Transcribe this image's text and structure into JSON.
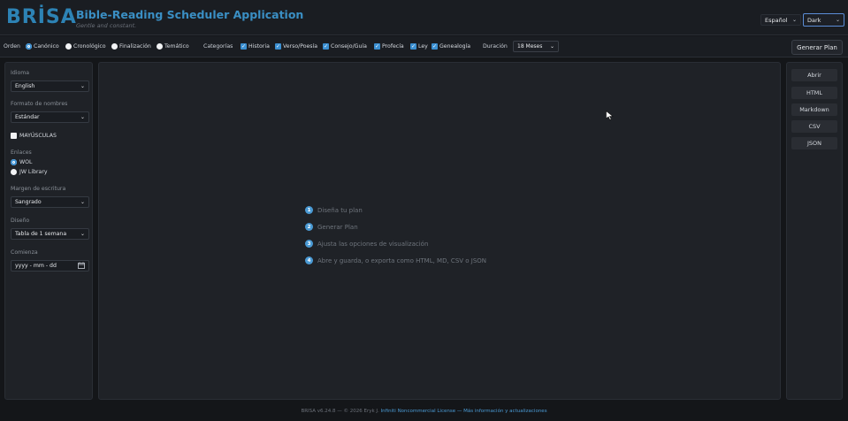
{
  "header": {
    "logo": "BRİSA",
    "title": "Bible-Reading Scheduler Application",
    "subtitle": "Gentle and constant.",
    "language": "Español",
    "theme": "Dark"
  },
  "toolbar": {
    "order_label": "Orden",
    "order_options": [
      {
        "label": "Canónico",
        "selected": true
      },
      {
        "label": "Cronológico",
        "selected": false
      },
      {
        "label": "Finalización",
        "selected": false
      },
      {
        "label": "Temático",
        "selected": false
      }
    ],
    "categories_label": "Categorías",
    "categories": [
      {
        "label": "Historia",
        "checked": true
      },
      {
        "label": "Verso/Poesía",
        "checked": true
      },
      {
        "label": "Consejo/Guía",
        "checked": true
      },
      {
        "label": "Profecía",
        "checked": true
      },
      {
        "label": "Ley",
        "checked": true
      },
      {
        "label": "Genealogía",
        "checked": true
      }
    ],
    "duration_label": "Duración",
    "duration_value": "18 Meses",
    "generate_label": "Generar Plan"
  },
  "sidebar": {
    "language_label": "Idioma",
    "language_value": "English",
    "name_format_label": "Formato de nombres",
    "name_format_value": "Estándar",
    "uppercase_label": "MAYÚSCULAS",
    "links_label": "Enlaces",
    "links_options": [
      {
        "label": "WOL",
        "selected": true
      },
      {
        "label": "JW Library",
        "selected": false
      }
    ],
    "margin_label": "Margen de escritura",
    "margin_value": "Sangrado",
    "design_label": "Diseño",
    "design_value": "Tabla de 1 semana",
    "start_label": "Comienza",
    "start_placeholder": "yyyy - mm - dd"
  },
  "main": {
    "steps": [
      {
        "num": "1",
        "text": "Diseña tu plan"
      },
      {
        "num": "2",
        "text": "Generar Plan"
      },
      {
        "num": "3",
        "text": "Ajusta las opciones de visualización"
      },
      {
        "num": "4",
        "text": "Abre y guarda, o exporta como HTML, MD, CSV o JSON"
      }
    ]
  },
  "actions": {
    "open": "Abrir",
    "html": "HTML",
    "markdown": "Markdown",
    "csv": "CSV",
    "json": "JSON"
  },
  "footer": {
    "text": "BRISA v6.24.8 — © 2026 Eryk J.",
    "license": "Infiniti Noncommercial License",
    "separator": "—",
    "more": "Más información y actualizaciones"
  }
}
